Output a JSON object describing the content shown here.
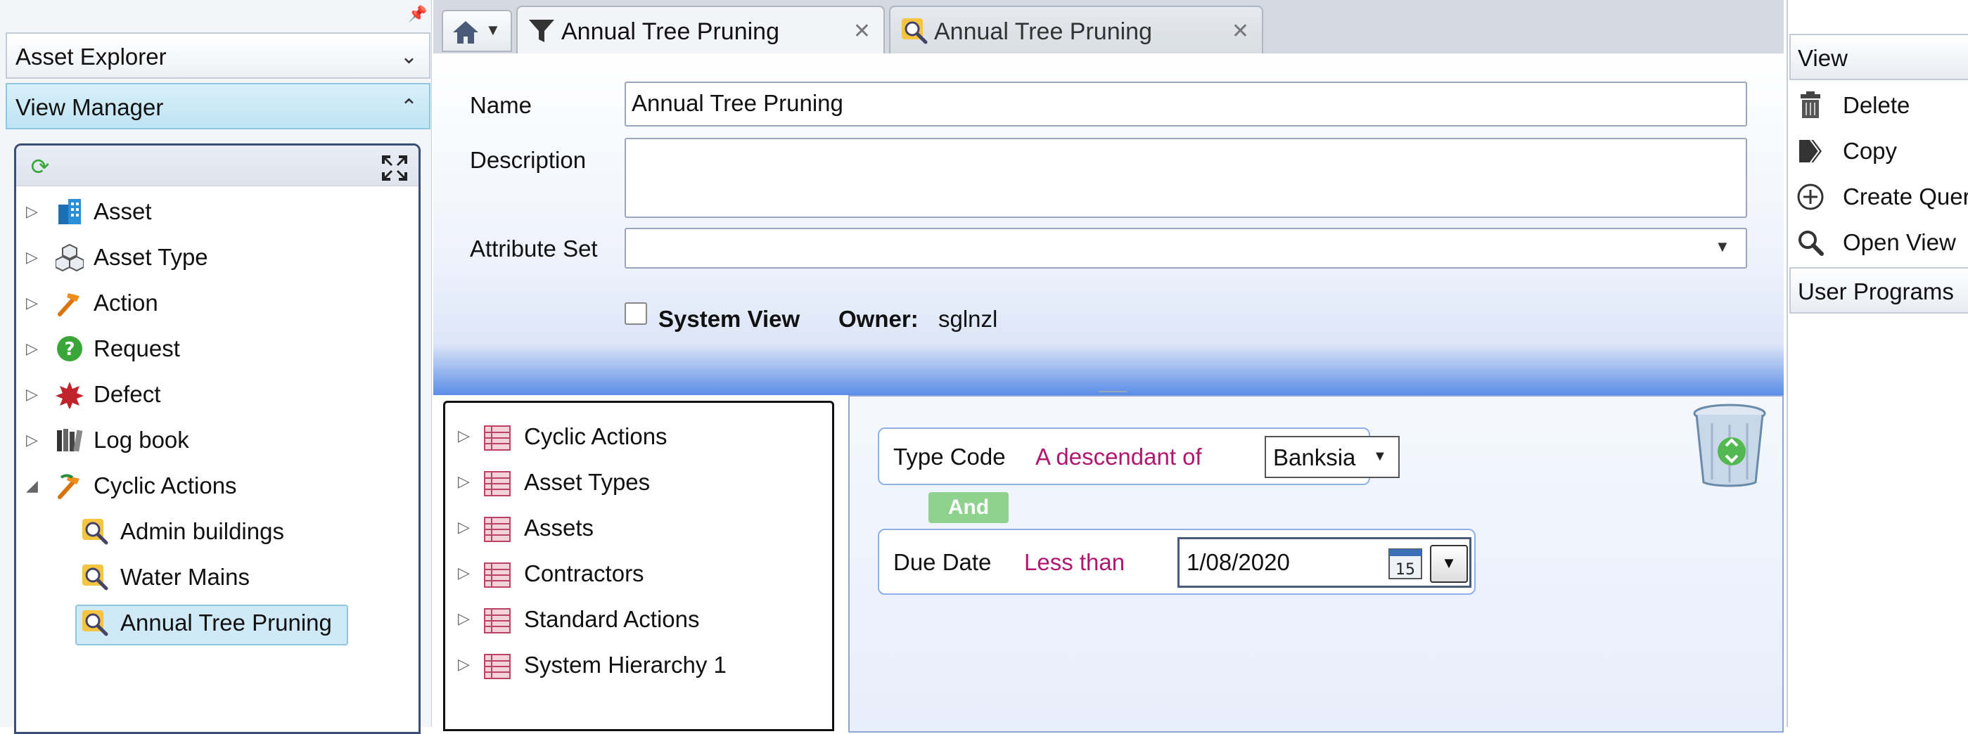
{
  "left_panel": {
    "asset_explorer_label": "Asset Explorer",
    "view_manager_label": "View Manager",
    "tree": [
      {
        "label": "Asset",
        "icon": "building-icon"
      },
      {
        "label": "Asset Type",
        "icon": "cubes-icon"
      },
      {
        "label": "Action",
        "icon": "hammer-icon"
      },
      {
        "label": "Request",
        "icon": "question-icon"
      },
      {
        "label": "Defect",
        "icon": "defect-burst-icon"
      },
      {
        "label": "Log book",
        "icon": "books-icon"
      },
      {
        "label": "Cyclic Actions",
        "icon": "cyclic-tools-icon",
        "expanded": true
      },
      {
        "label": "Admin buildings",
        "icon": "view-magnifier-icon"
      },
      {
        "label": "Water Mains",
        "icon": "view-magnifier-icon"
      },
      {
        "label": "Annual Tree Pruning",
        "icon": "view-magnifier-icon",
        "selected": true
      }
    ]
  },
  "tabs": [
    {
      "label": "Annual Tree Pruning",
      "icon": "filter-icon",
      "active": true
    },
    {
      "label": "Annual Tree Pruning",
      "icon": "view-magnifier-icon",
      "active": false
    }
  ],
  "form": {
    "name_label": "Name",
    "name_value": "Annual Tree Pruning",
    "description_label": "Description",
    "description_value": "",
    "attribute_set_label": "Attribute Set",
    "attribute_set_value": "",
    "system_view_label": "System View",
    "system_view_checked": false,
    "owner_label": "Owner:",
    "owner_value": "sglnzl"
  },
  "entity_tree": [
    "Cyclic Actions",
    "Asset Types",
    "Assets",
    "Contractors",
    "Standard Actions",
    "System Hierarchy 1"
  ],
  "query": {
    "criteria1": {
      "field": "Type Code",
      "operator": "A descendant of",
      "value": "Banksia"
    },
    "and_label": "And",
    "criteria2": {
      "field": "Due Date",
      "operator": "Less than",
      "value": "1/08/2020",
      "calendar_day": "15"
    }
  },
  "right_panel": {
    "view_header": "View",
    "items": [
      {
        "label": "Delete",
        "icon": "trash-icon"
      },
      {
        "label": "Copy",
        "icon": "copy-icon"
      },
      {
        "label": "Create Query",
        "icon": "plus-circle-icon"
      },
      {
        "label": "Open View",
        "icon": "magnifier-icon"
      }
    ],
    "user_programs_header": "User Programs"
  },
  "colors": {
    "selection": "#cfe9f6",
    "operator_text": "#b0186f",
    "and_button": "#8fd28f",
    "criteria_border": "#8fb1e8"
  }
}
